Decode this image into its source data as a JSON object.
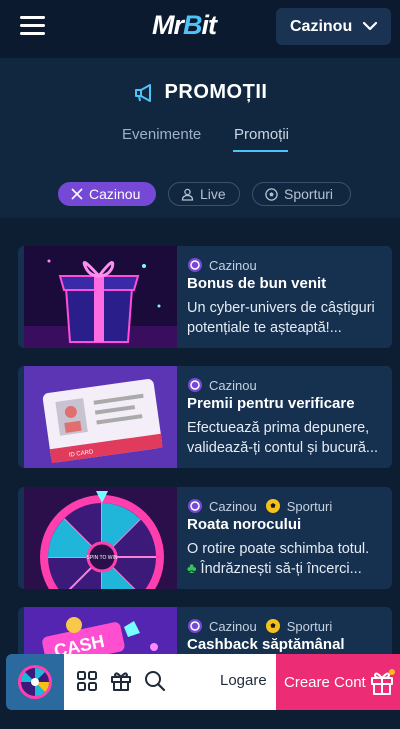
{
  "header": {
    "logo_mr": "Mr",
    "logo_b": "B",
    "logo_it": "it",
    "section_select": "Cazinou"
  },
  "promo": {
    "title": "PROMOȚII",
    "tabs": [
      {
        "label": "Evenimente",
        "active": false
      },
      {
        "label": "Promoții",
        "active": true
      }
    ],
    "filters": [
      {
        "label": "Cazinou",
        "active": true,
        "icon": "close-icon"
      },
      {
        "label": "Live",
        "active": false,
        "icon": "dealer-icon"
      },
      {
        "label": "Sporturi",
        "active": false,
        "icon": "soccer-ball-icon"
      }
    ]
  },
  "cards": [
    {
      "tags": [
        "Cazinou"
      ],
      "title": "Bonus de bun venit",
      "desc": "Un cyber-univers de câștiguri potențiale te așteaptă!..."
    },
    {
      "tags": [
        "Cazinou"
      ],
      "title": "Premii pentru verificare",
      "desc": "Efectuează prima depunere, validează-ți contul și bucură..."
    },
    {
      "tags": [
        "Cazinou",
        "Sporturi"
      ],
      "title": "Roata norocului",
      "desc_line1": "O rotire poate schimba totul.",
      "desc_line2": "Îndrăznești să-ți încerci..."
    },
    {
      "tags": [
        "Cazinou",
        "Sporturi"
      ],
      "title": "Cashback săptămânal",
      "desc": ""
    }
  ],
  "thumb_text": {
    "id_card": "ID CARD",
    "wheel_center": "SPIN TO WIN",
    "cash": "CASH"
  },
  "bottom_bar": {
    "login": "Logare",
    "register": "Creare Cont"
  },
  "colors": {
    "accent_blue": "#4ec3f7",
    "chip_active": "#7548d6",
    "register": "#ec2c74",
    "background": "#0d1e33"
  }
}
